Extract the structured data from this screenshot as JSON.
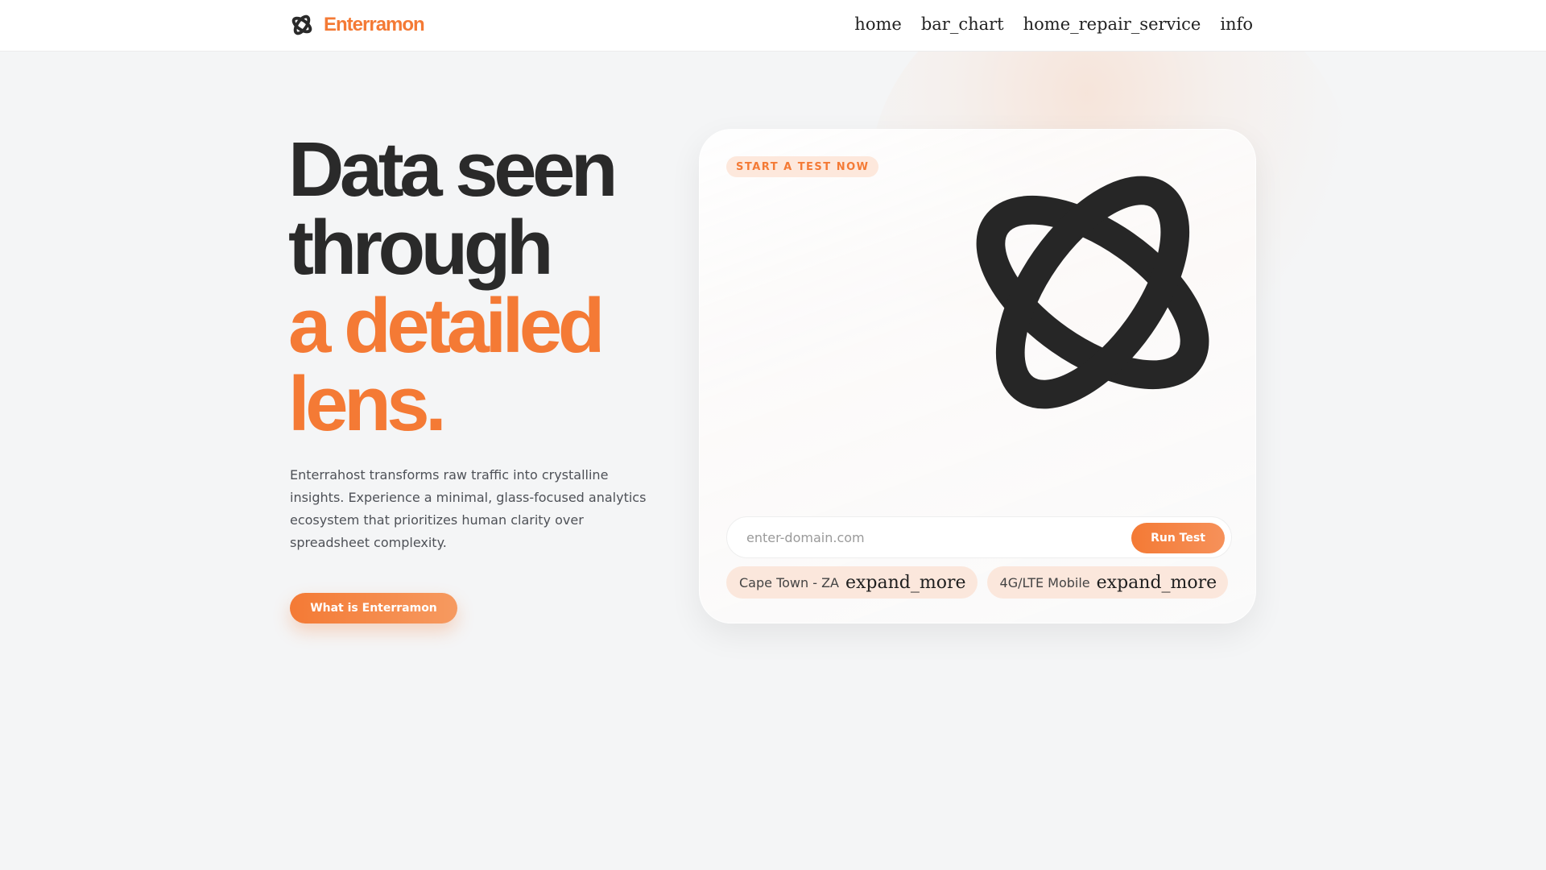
{
  "brand": {
    "name": "Enterramon",
    "logo_icon": "atom-logo-icon"
  },
  "nav": {
    "items": [
      {
        "label": "home"
      },
      {
        "label": "bar_chart"
      },
      {
        "label": "home_repair_service"
      },
      {
        "label": "info"
      }
    ]
  },
  "hero": {
    "title_line1": "Data seen",
    "title_line2": "through",
    "title_line3": "a detailed",
    "title_line4": "lens.",
    "description": "Enterrahost transforms raw traffic into crystalline insights. Experience a minimal, glass-focused analytics ecosystem that prioritizes human clarity over spreadsheet complexity.",
    "cta_label": "What is Enterramon"
  },
  "test_card": {
    "badge": "START A TEST NOW",
    "domain_placeholder": "enter-domain.com",
    "run_label": "Run Test",
    "location_value": "Cape Town - ZA",
    "location_icon": "expand_more",
    "network_value": "4G/LTE Mobile",
    "network_icon": "expand_more"
  },
  "colors": {
    "accent": "#f47a35",
    "text_dark": "#2a2a2a",
    "background": "#f4f5f6"
  }
}
